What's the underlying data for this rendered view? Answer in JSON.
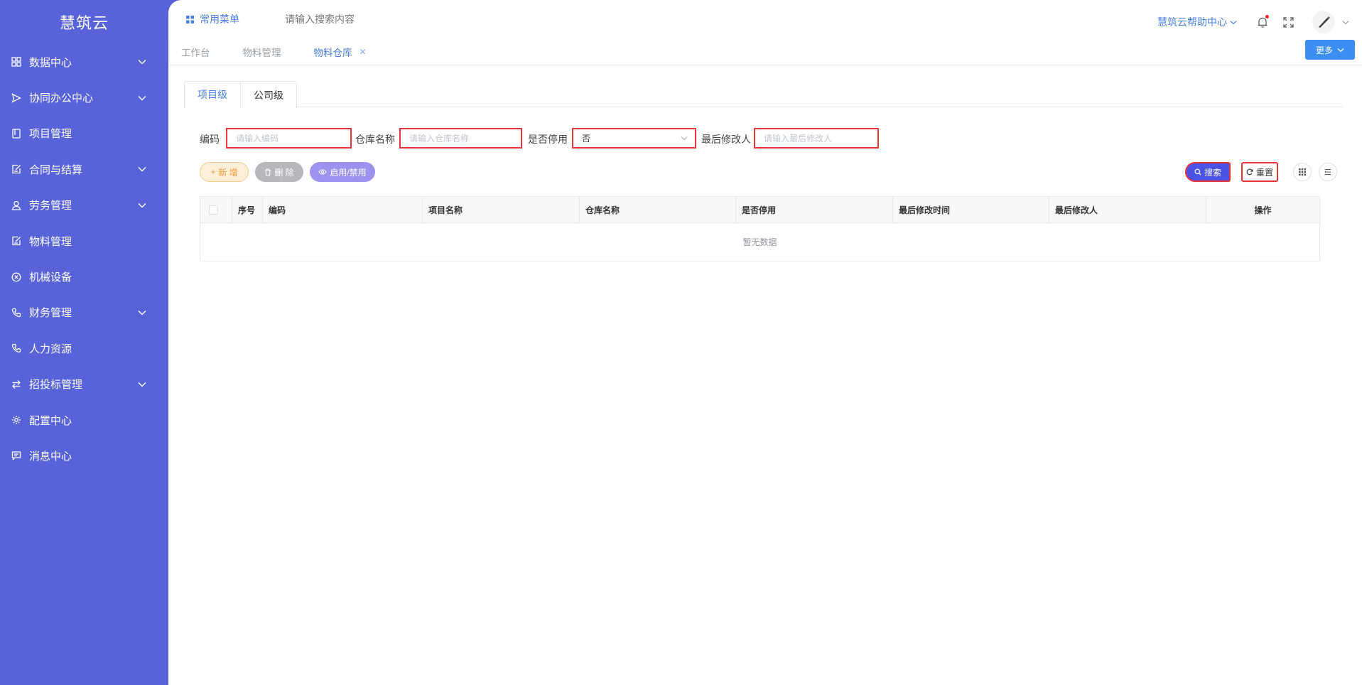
{
  "sidebar": {
    "logo": "慧筑云",
    "items": [
      {
        "label": "数据中心",
        "icon": "grid-icon",
        "expandable": true
      },
      {
        "label": "协同办公中心",
        "icon": "send-icon",
        "expandable": true
      },
      {
        "label": "项目管理",
        "icon": "book-icon",
        "expandable": false
      },
      {
        "label": "合同与结算",
        "icon": "edit-doc-icon",
        "expandable": true
      },
      {
        "label": "劳务管理",
        "icon": "worker-icon",
        "expandable": true
      },
      {
        "label": "物料管理",
        "icon": "edit-doc-icon",
        "expandable": false
      },
      {
        "label": "机械设备",
        "icon": "circle-x-icon",
        "expandable": false
      },
      {
        "label": "财务管理",
        "icon": "phone-icon",
        "expandable": true
      },
      {
        "label": "人力资源",
        "icon": "phone-icon",
        "expandable": false
      },
      {
        "label": "招投标管理",
        "icon": "exchange-icon",
        "expandable": true
      },
      {
        "label": "配置中心",
        "icon": "gear-icon",
        "expandable": false
      },
      {
        "label": "消息中心",
        "icon": "message-icon",
        "expandable": false
      }
    ]
  },
  "topbar": {
    "favorites_label": "常用菜单",
    "search_placeholder": "请输入搜索内容",
    "help_label": "慧筑云帮助中心"
  },
  "page_tabs": {
    "items": [
      {
        "label": "工作台",
        "active": false
      },
      {
        "label": "物料管理",
        "active": false
      },
      {
        "label": "物料仓库",
        "active": true,
        "closable": true
      }
    ],
    "more_label": "更多"
  },
  "level_tabs": [
    "项目级",
    "公司级"
  ],
  "filters": {
    "code_label": "编码",
    "code_placeholder": "请输入编码",
    "warehouse_label": "仓库名称",
    "warehouse_placeholder": "请输入仓库名称",
    "disabled_label": "是否停用",
    "disabled_value": "否",
    "modifier_label": "最后修改人",
    "modifier_placeholder": "请输入最后修改人"
  },
  "actions": {
    "add_label": "新 增",
    "delete_label": "删 除",
    "toggle_label": "启用/禁用",
    "search_label": "搜索",
    "reset_label": "重置"
  },
  "table": {
    "columns": [
      "序号",
      "编码",
      "项目名称",
      "仓库名称",
      "是否停用",
      "最后修改时间",
      "最后修改人",
      "操作"
    ],
    "empty_text": "暂无数据"
  },
  "colors": {
    "sidebar_bg": "#5862d9",
    "accent": "#4a7fe0",
    "highlight_border": "#e8343b"
  }
}
